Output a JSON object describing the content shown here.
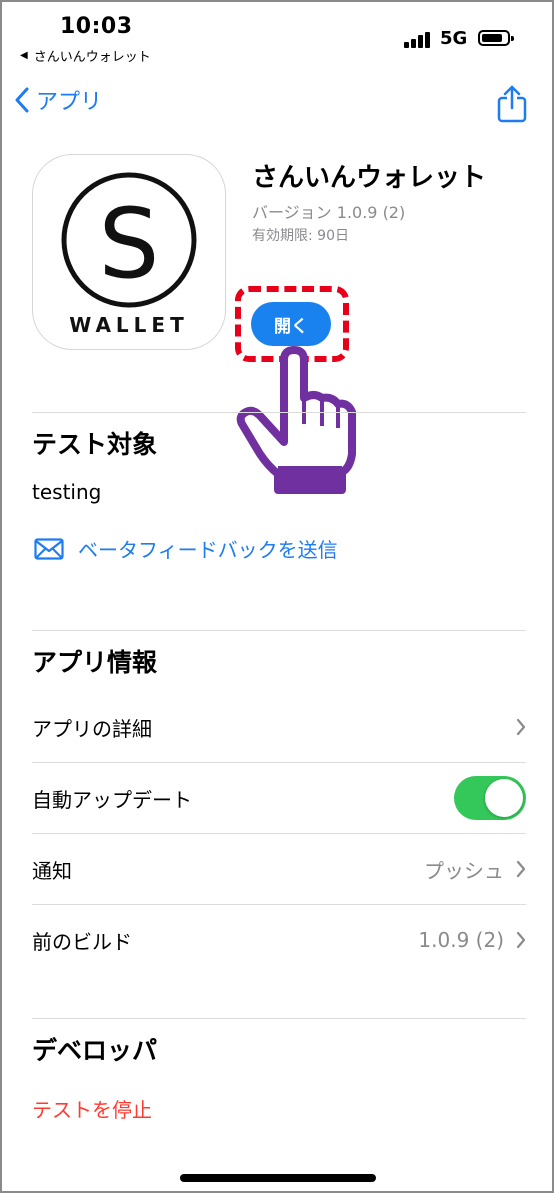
{
  "status_bar": {
    "time": "10:03",
    "back_app": "さんいんウォレット",
    "network": "5G"
  },
  "nav": {
    "back_label": "アプリ"
  },
  "app": {
    "name": "さんいんウォレット",
    "version": "バージョン 1.0.9 (2)",
    "expiry": "有効期限: 90日",
    "icon_text": "WALLET",
    "icon_letter": "S",
    "open_label": "開く"
  },
  "test_target": {
    "title": "テスト対象",
    "value": "testing",
    "feedback_label": "ベータフィードバックを送信"
  },
  "app_info": {
    "title": "アプリ情報",
    "rows": [
      {
        "label": "アプリの詳細",
        "value": ""
      },
      {
        "label": "自動アップデート",
        "value": ""
      },
      {
        "label": "通知",
        "value": "プッシュ"
      },
      {
        "label": "前のビルド",
        "value": "1.0.9 (2)"
      }
    ]
  },
  "developer": {
    "title": "デベロッパ",
    "stop_label": "テストを停止"
  },
  "colors": {
    "accent": "#1d7cf2",
    "open_button": "#1a82ee",
    "toggle_on": "#34c759",
    "destructive": "#ff3b30",
    "highlight": "#e8001b",
    "pointer_hand": "#7030a0"
  },
  "auto_update_enabled": true
}
